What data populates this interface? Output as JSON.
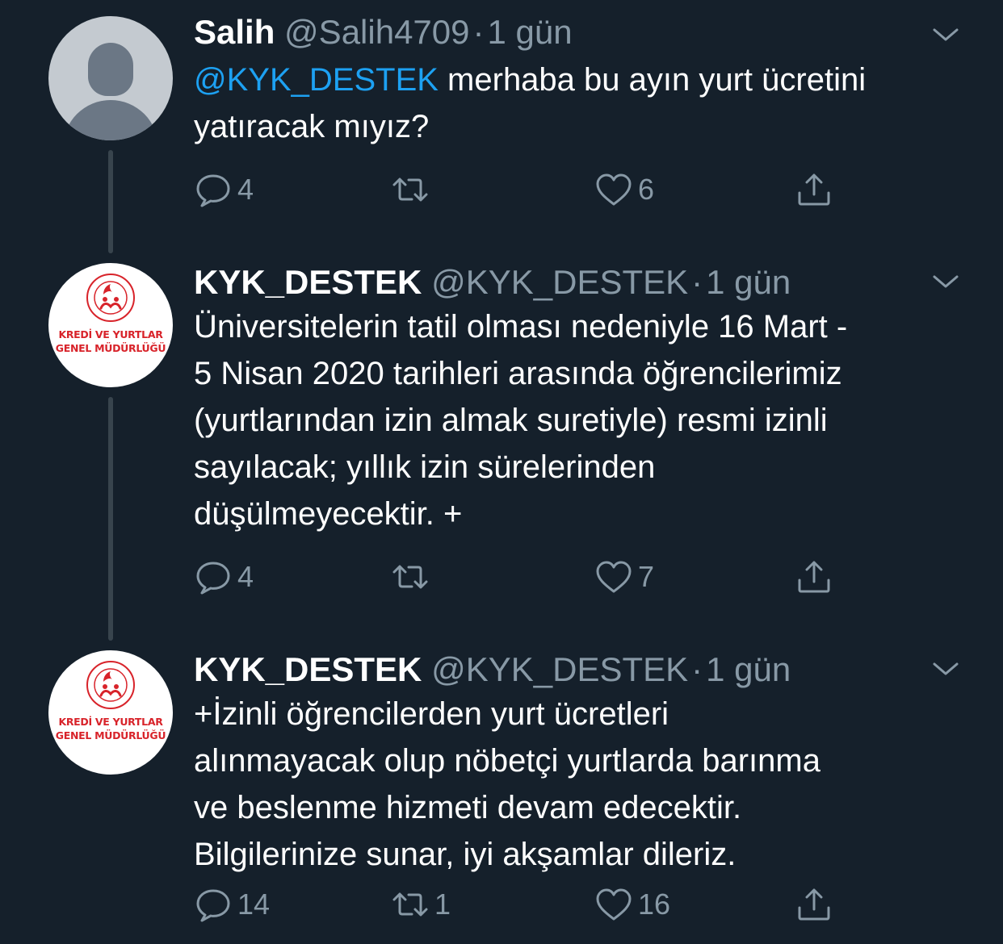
{
  "tweets": [
    {
      "display_name": "Salih",
      "handle": "@Salih4709",
      "separator": "·",
      "time": "1 gün",
      "avatar_icon": "default-profile-icon",
      "text_lines": [
        {
          "mention": "@KYK_DESTEK",
          "rest": " merhaba bu ayın yurt ücretini"
        },
        {
          "mention": "",
          "rest": "yatıracak mıyız?"
        }
      ],
      "actions": {
        "replies": "4",
        "retweets": "",
        "likes": "6"
      }
    },
    {
      "display_name": "KYK_DESTEK",
      "handle": "@KYK_DESTEK",
      "separator": "·",
      "time": "1 gün",
      "avatar_org_lines": [
        "KREDİ VE YURTLAR",
        "GENEL MÜDÜRLÜĞÜ"
      ],
      "text_lines": [
        "Üniversitelerin tatil olması nedeniyle 16 Mart -",
        "5 Nisan 2020 tarihleri arasında öğrencilerimiz",
        "(yurtlarından izin almak suretiyle) resmi izinli",
        "sayılacak; yıllık izin sürelerinden",
        "düşülmeyecektir. +"
      ],
      "actions": {
        "replies": "4",
        "retweets": "",
        "likes": "7"
      }
    },
    {
      "display_name": "KYK_DESTEK",
      "handle": "@KYK_DESTEK",
      "separator": "·",
      "time": "1 gün",
      "avatar_org_lines": [
        "KREDİ VE YURTLAR",
        "GENEL MÜDÜRLÜĞÜ"
      ],
      "text_lines": [
        "+İzinli öğrencilerden yurt ücretleri",
        "alınmayacak olup nöbetçi yurtlarda barınma",
        "ve beslenme hizmeti devam edecektir.",
        "Bilgilerinize sunar, iyi akşamlar dileriz."
      ],
      "actions": {
        "replies": "14",
        "retweets": "1",
        "likes": "16"
      }
    }
  ],
  "icons": {
    "reply": "reply-icon",
    "retweet": "retweet-icon",
    "like": "heart-icon",
    "share": "share-icon",
    "more": "chevron-down-icon"
  },
  "colors": {
    "background": "#15202b",
    "text": "#ffffff",
    "secondary": "#8899a6",
    "mention": "#1da1f2",
    "thread_line": "#38444d",
    "org_red": "#d8232a"
  }
}
